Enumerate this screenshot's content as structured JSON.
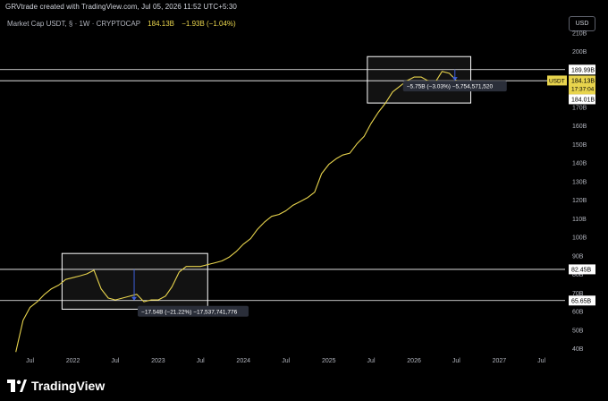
{
  "header": {
    "caption": "GRVtrade created with TradingView.com, Jul 05, 2026 11:52 UTC+5:30"
  },
  "legend": {
    "symbol": "Market Cap USDT, § · 1W · CRYPTOCAP",
    "price": "184.13B",
    "change": "−1.93B (−1.04%)"
  },
  "currency_button": "USD",
  "footer": {
    "brand": "TradingView"
  },
  "colors": {
    "background": "#000000",
    "line": "#e8d44d",
    "level_lines": "#ffffff",
    "measure_arrow": "#3d5fd8",
    "axis_text": "#b2b5be"
  },
  "chart_data": {
    "type": "line",
    "title": "Market Cap USDT",
    "interval": "1W",
    "source": "CRYPTOCAP",
    "x_ticks": [
      "Jul",
      "2022",
      "Jul",
      "2023",
      "Jul",
      "2024",
      "Jul",
      "2025",
      "Jul",
      "2026",
      "Jul",
      "2027",
      "Jul"
    ],
    "y_ticks": [
      "210B",
      "200B",
      "190B",
      "180B",
      "170B",
      "160B",
      "150B",
      "140B",
      "130B",
      "120B",
      "110B",
      "100B",
      "90B",
      "80B",
      "70B",
      "60B",
      "50B",
      "40B"
    ],
    "ylim": [
      36,
      212
    ],
    "series": [
      {
        "x": [
          "2021-05-01",
          "2021-06-01",
          "2021-07-01",
          "2021-08-01",
          "2021-09-01",
          "2021-10-01",
          "2021-11-01",
          "2021-12-01",
          "2022-01-01",
          "2022-02-01",
          "2022-03-01",
          "2022-04-01",
          "2022-05-01",
          "2022-06-01",
          "2022-07-01",
          "2022-08-01",
          "2022-09-01",
          "2022-10-01",
          "2022-11-01",
          "2022-12-01",
          "2023-01-01",
          "2023-02-01",
          "2023-03-01",
          "2023-04-01",
          "2023-05-01",
          "2023-06-01",
          "2023-07-01",
          "2023-08-01",
          "2023-09-01",
          "2023-10-01",
          "2023-11-01",
          "2023-12-01",
          "2024-01-01",
          "2024-02-01",
          "2024-03-01",
          "2024-04-01",
          "2024-05-01",
          "2024-06-01",
          "2024-07-01",
          "2024-08-01",
          "2024-09-01",
          "2024-10-01",
          "2024-11-01",
          "2024-12-01",
          "2025-01-01",
          "2025-02-01",
          "2025-03-01",
          "2025-04-01",
          "2025-05-01",
          "2025-06-01",
          "2025-07-01",
          "2025-08-01",
          "2025-09-01",
          "2025-10-01",
          "2025-11-01",
          "2025-12-01",
          "2026-01-01",
          "2026-02-01",
          "2026-03-01",
          "2026-04-01",
          "2026-05-01",
          "2026-06-01",
          "2026-07-01"
        ],
        "values": [
          38,
          55,
          62,
          65,
          69,
          72,
          74,
          77,
          78,
          79,
          80,
          82,
          72,
          67,
          66,
          67,
          68,
          69,
          65,
          66,
          66,
          68,
          73,
          81,
          84,
          84,
          84,
          85,
          86,
          87,
          89,
          92,
          96,
          99,
          104,
          108,
          111,
          112,
          114,
          117,
          119,
          121,
          124,
          134,
          139,
          142,
          144,
          145,
          150,
          154,
          161,
          167,
          172,
          178,
          181,
          184,
          186,
          186,
          184,
          183,
          189,
          188,
          184.13
        ]
      }
    ],
    "horizontal_levels": [
      {
        "value": 189.99,
        "label": "189.99B"
      },
      {
        "value": 184.01,
        "label": "184.01B"
      },
      {
        "value": 82.45,
        "label": "82.45B"
      },
      {
        "value": 65.65,
        "label": "65.65B"
      }
    ],
    "price_tag": {
      "symbol": "USDT",
      "value": 184.13,
      "label": "184.13B",
      "countdown": "17:37:04"
    },
    "measurements": [
      {
        "label": "−17.54B (−21.22%) −17,537,741,776",
        "x_from": "2021-11-15",
        "x_to": "2023-08-01",
        "y_from": 61,
        "y_to": 91,
        "arrow_x": "2022-09-20",
        "arrow_from": 82.45,
        "arrow_to": 65.65
      },
      {
        "label": "−5.75B (−3.03%) −5,754,571,520",
        "x_from": "2025-06-15",
        "x_to": "2026-09-01",
        "y_from": 172,
        "y_to": 197,
        "arrow_x": "2026-06-25",
        "arrow_from": 189.99,
        "arrow_to": 184.01
      }
    ]
  }
}
